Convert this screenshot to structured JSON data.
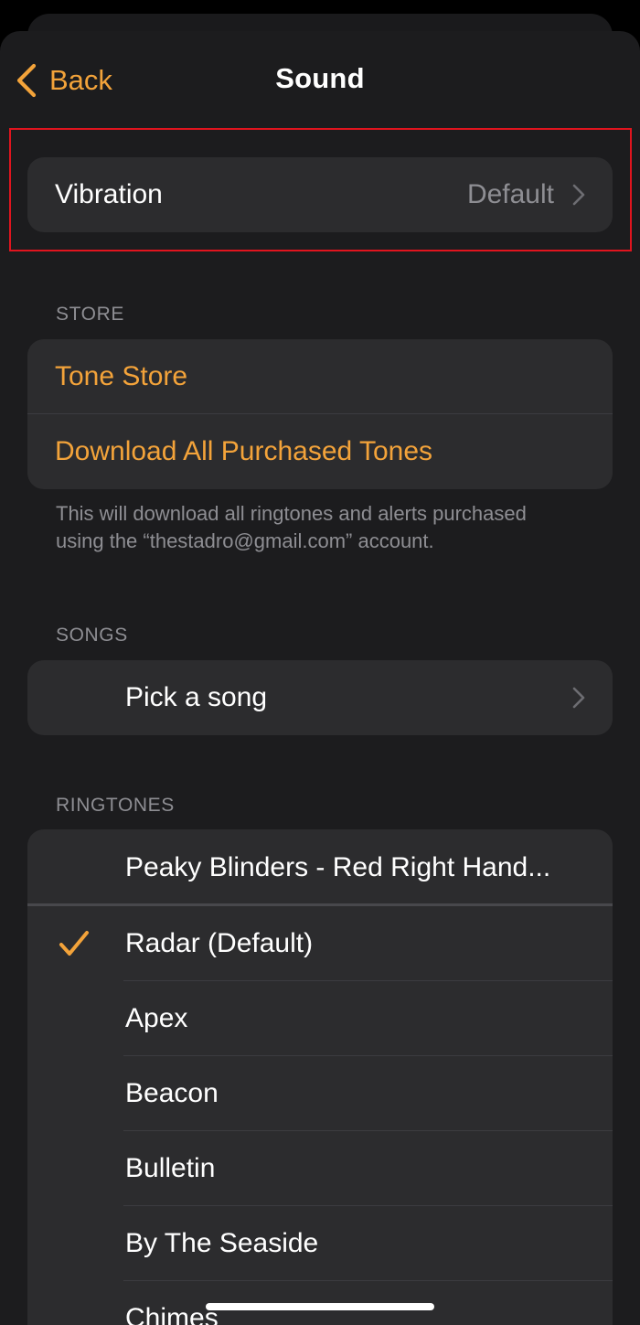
{
  "nav": {
    "back_label": "Back",
    "title": "Sound"
  },
  "vibration": {
    "label": "Vibration",
    "value": "Default"
  },
  "store": {
    "header": "STORE",
    "tone_store": "Tone Store",
    "download_all": "Download All Purchased Tones",
    "footnote": "This will download all ringtones and alerts purchased using the “thestadro@gmail.com” account."
  },
  "songs": {
    "header": "SONGS",
    "pick": "Pick a song"
  },
  "ringtones": {
    "header": "RINGTONES",
    "custom": "Peaky Blinders - Red Right Hand...",
    "items": [
      {
        "label": "Radar (Default)",
        "selected": true
      },
      {
        "label": "Apex",
        "selected": false
      },
      {
        "label": "Beacon",
        "selected": false
      },
      {
        "label": "Bulletin",
        "selected": false
      },
      {
        "label": "By The Seaside",
        "selected": false
      },
      {
        "label": "Chimes",
        "selected": false
      }
    ]
  },
  "colors": {
    "accent": "#f3a33a",
    "background": "#1c1c1e",
    "cell": "#2c2c2e",
    "secondary_text": "#8e8e93",
    "highlight": "#e0141e"
  }
}
